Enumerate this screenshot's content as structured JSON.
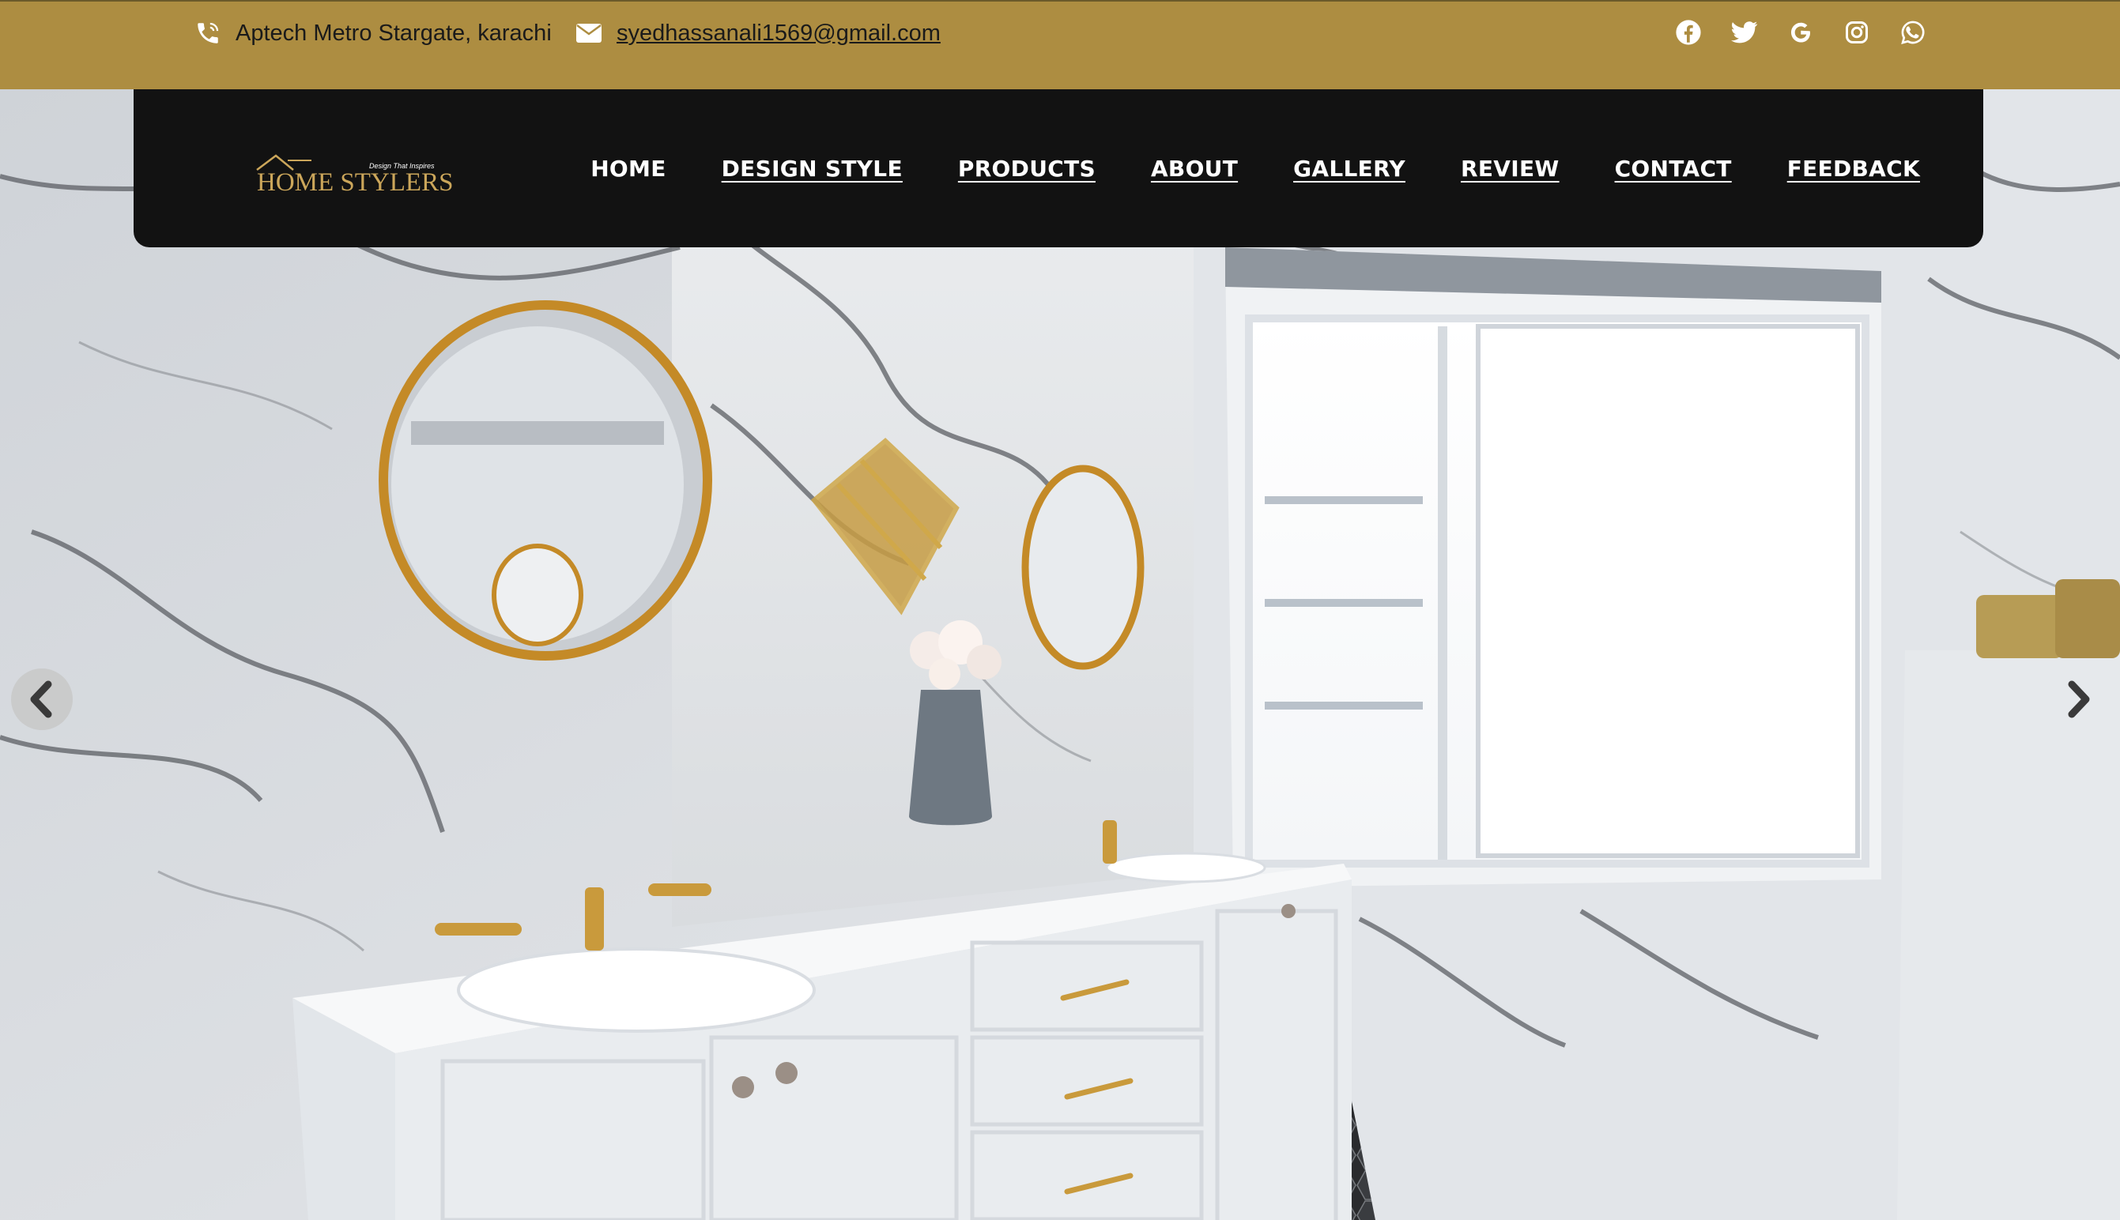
{
  "topbar": {
    "address": "Aptech Metro Stargate, karachi",
    "email": "syedhassanali1569@gmail.com",
    "socials": [
      "facebook-icon",
      "twitter-icon",
      "google-icon",
      "instagram-icon",
      "whatsapp-icon"
    ]
  },
  "logo": {
    "brand": "HOME STYLERS",
    "tagline": "Design That Inspires"
  },
  "nav": {
    "home": "HOME",
    "design_style": "DESIGN STYLE",
    "products": "PRODUCTS",
    "about": "ABOUT",
    "gallery": "GALLERY",
    "review": "REVIEW",
    "contact": "CONTACT",
    "feedback": "FEEDBACK"
  },
  "slider": {
    "prev_icon": "chevron-left-icon",
    "next_icon": "chevron-right-icon"
  },
  "colors": {
    "topbar": "#ad8d41",
    "navbar": "#121212",
    "gold": "#c9a24a"
  }
}
